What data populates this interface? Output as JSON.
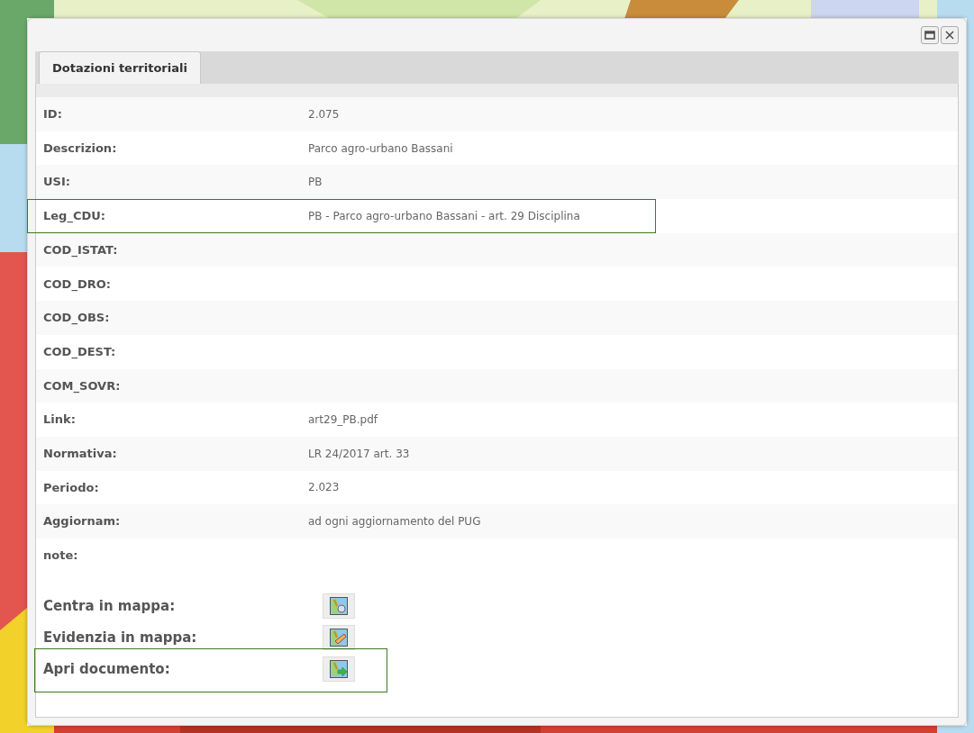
{
  "window": {
    "tabs": [
      {
        "label": "Dotazioni territoriali",
        "selected": true
      }
    ]
  },
  "fields": [
    {
      "label": "ID:",
      "value": "2.075",
      "highlighted": false
    },
    {
      "label": "Descrizion:",
      "value": "Parco agro-urbano Bassani",
      "highlighted": false
    },
    {
      "label": "USI:",
      "value": "PB",
      "highlighted": false
    },
    {
      "label": "Leg_CDU:",
      "value": "PB - Parco agro-urbano Bassani - art. 29 Disciplina",
      "highlighted": true
    },
    {
      "label": "COD_ISTAT:",
      "highlighted": false
    },
    {
      "label": "COD_DRO:",
      "highlighted": false
    },
    {
      "label": "COD_OBS:",
      "highlighted": false
    },
    {
      "label": "COD_DEST:",
      "highlighted": false
    },
    {
      "label": "COM_SOVR:",
      "highlighted": false
    },
    {
      "label": "Link:",
      "value": "art29_PB.pdf",
      "highlighted": false
    },
    {
      "label": "Normativa:",
      "value": "LR 24/2017 art. 33",
      "highlighted": false
    },
    {
      "label": "Periodo:",
      "value": "2.023",
      "highlighted": false
    },
    {
      "label": "Aggiornam:",
      "value": "ad ogni aggiornamento del PUG",
      "highlighted": false
    },
    {
      "label": "note:",
      "highlighted": false
    }
  ],
  "actions": [
    {
      "label": "Centra in mappa:",
      "kind": "center",
      "highlighted": false
    },
    {
      "label": "Evidenzia in mappa:",
      "kind": "highlight",
      "highlighted": false
    },
    {
      "label": "Apri documento:",
      "kind": "open",
      "highlighted": true
    }
  ]
}
